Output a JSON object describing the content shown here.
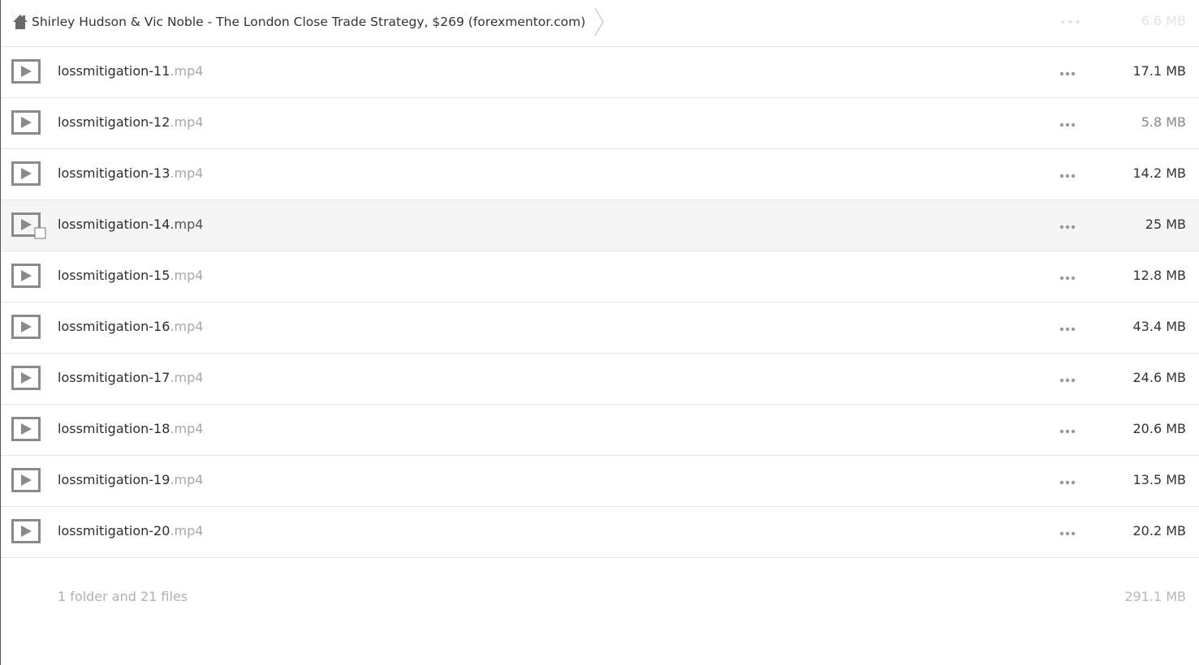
{
  "breadcrumb": {
    "title": "Shirley Hudson & Vic Noble - The London Close Trade Strategy, $269 (forexmentor.com)"
  },
  "hidden_row": {
    "size": "6.6 MB"
  },
  "files": [
    {
      "base": "lossmitigation-11",
      "ext": ".mp4",
      "size": "17.1 MB"
    },
    {
      "base": "lossmitigation-12",
      "ext": ".mp4",
      "size": "5.8 MB"
    },
    {
      "base": "lossmitigation-13",
      "ext": ".mp4",
      "size": "14.2 MB"
    },
    {
      "base": "lossmitigation-14",
      "ext": ".mp4",
      "size": "25 MB"
    },
    {
      "base": "lossmitigation-15",
      "ext": ".mp4",
      "size": "12.8 MB"
    },
    {
      "base": "lossmitigation-16",
      "ext": ".mp4",
      "size": "43.4 MB"
    },
    {
      "base": "lossmitigation-17",
      "ext": ".mp4",
      "size": "24.6 MB"
    },
    {
      "base": "lossmitigation-18",
      "ext": ".mp4",
      "size": "20.6 MB"
    },
    {
      "base": "lossmitigation-19",
      "ext": ".mp4",
      "size": "13.5 MB"
    },
    {
      "base": "lossmitigation-20",
      "ext": ".mp4",
      "size": "20.2 MB"
    }
  ],
  "summary": {
    "count": "1 folder and 21 files",
    "total": "291.1 MB"
  },
  "colors": {
    "icon_gray": "#8a8a8a",
    "row_border": "#e6e6e6",
    "hover_bg": "#f5f5f5"
  }
}
